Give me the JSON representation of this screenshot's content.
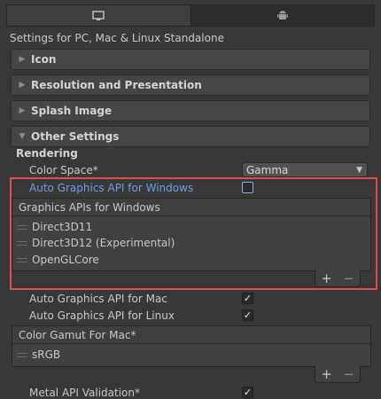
{
  "tabs": [
    {
      "icon": "monitor-icon",
      "active": true
    },
    {
      "icon": "android-icon",
      "active": false
    }
  ],
  "platform_title": "Settings for PC, Mac & Linux Standalone",
  "foldouts": {
    "icon": "Icon",
    "resolution": "Resolution and Presentation",
    "splash": "Splash Image",
    "other": "Other Settings"
  },
  "rendering": {
    "header": "Rendering",
    "color_space_label": "Color Space*",
    "color_space_value": "Gamma",
    "auto_api_windows_label": "Auto Graphics API  for Windows",
    "auto_api_windows_checked": false,
    "graphics_apis_header": "Graphics APIs for Windows",
    "graphics_apis": [
      "Direct3D11",
      "Direct3D12 (Experimental)",
      "OpenGLCore"
    ],
    "auto_api_mac_label": "Auto Graphics API  for Mac",
    "auto_api_mac_checked": true,
    "auto_api_linux_label": "Auto Graphics API  for Linux",
    "auto_api_linux_checked": true,
    "color_gamut_header": "Color Gamut For Mac*",
    "color_gamut_items": [
      "sRGB"
    ],
    "metal_api_label": "Metal API Validation*",
    "metal_api_checked": true
  },
  "list_buttons": {
    "add": "+",
    "remove": "−"
  },
  "colors": {
    "highlight": "#e05050",
    "selected_label": "#6d9fe6"
  }
}
